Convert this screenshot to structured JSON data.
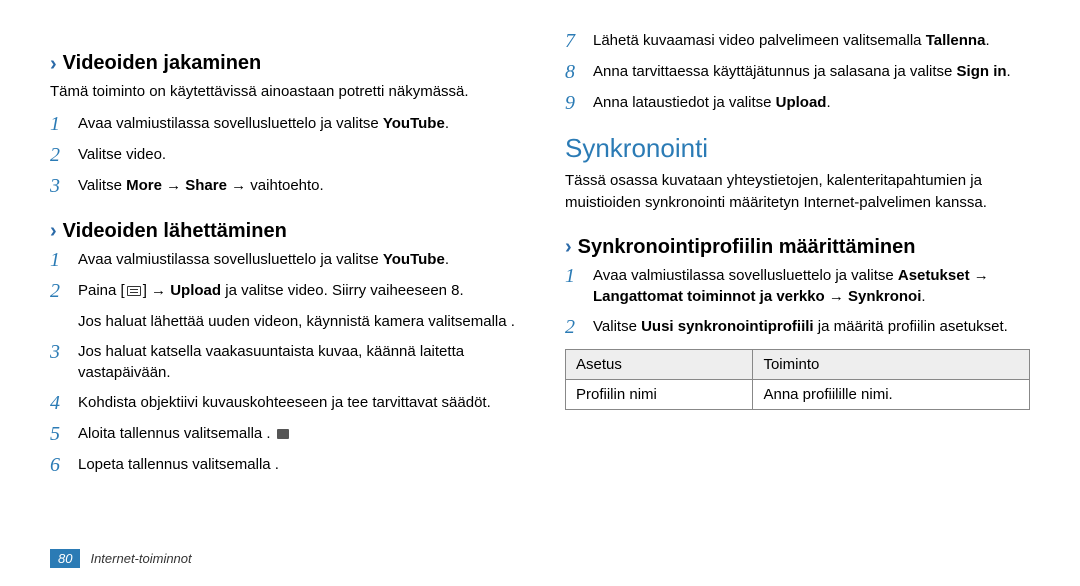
{
  "left": {
    "h1": "Videoiden jakaminen",
    "intro1": "Tämä toiminto on käytettävissä ainoastaan  potretti näkymässä.",
    "s1": {
      "a": "Avaa valmiustilassa sovellusluettelo ja valitse ",
      "b": "YouTube",
      "c": "."
    },
    "s2": "Valitse video.",
    "s3": {
      "a": "Valitse ",
      "b": "More",
      "c": " → ",
      "d": "Share",
      "e": " → vaihtoehto."
    },
    "h2": "Videoiden lähettäminen",
    "t1": {
      "a": "Avaa valmiustilassa sovellusluettelo ja valitse ",
      "b": "YouTube",
      "c": "."
    },
    "t2": {
      "a": "Paina [",
      "b": "] → ",
      "c": "Upload",
      "d": " ja valitse video. Siirry vaiheeseen 8."
    },
    "t2sub": "Jos haluat lähettää uuden videon, käynnistä kamera valitsemalla      .",
    "t3": "Jos haluat katsella vaakasuuntaista kuvaa, käännä laitetta vastapäivään.",
    "t4": "Kohdista objektiivi kuvauskohteeseen ja tee tarvittavat säädöt.",
    "t5": "Aloita tallennus valitsemalla       .",
    "t6": "Lopeta tallennus valitsemalla      ."
  },
  "right": {
    "r7": {
      "a": "Lähetä kuvaamasi video palvelimeen valitsemalla ",
      "b": "Tallenna",
      "c": "."
    },
    "r8": {
      "a": "Anna tarvittaessa käyttäjätunnus ja salasana ja valitse ",
      "b": "Sign in",
      "c": "."
    },
    "r9": {
      "a": "Anna lataustiedot ja valitse ",
      "b": "Upload",
      "c": "."
    },
    "main": "Synkronointi",
    "intro": "Tässä osassa kuvataan yhteystietojen, kalenteritapahtumien ja muistioiden synkronointi määritetyn Internet-palvelimen kanssa.",
    "sub": "Synkronointiprofiilin määrittäminen",
    "p1": {
      "a": "Avaa valmiustilassa sovellusluettelo ja valitse ",
      "b": "Asetukset",
      "c": " → ",
      "d": "Langattomat toiminnot ja verkko",
      "e": " → ",
      "f": "Synkronoi",
      "g": "."
    },
    "p2": {
      "a": "Valitse ",
      "b": "Uusi synkronointiprofiili",
      "c": " ja määritä profiilin asetukset."
    },
    "th1": "Asetus",
    "th2": "Toiminto",
    "td1": "Profiilin nimi",
    "td2": "Anna profiilille nimi."
  },
  "footer": {
    "page": "80",
    "section": "Internet-toiminnot"
  }
}
